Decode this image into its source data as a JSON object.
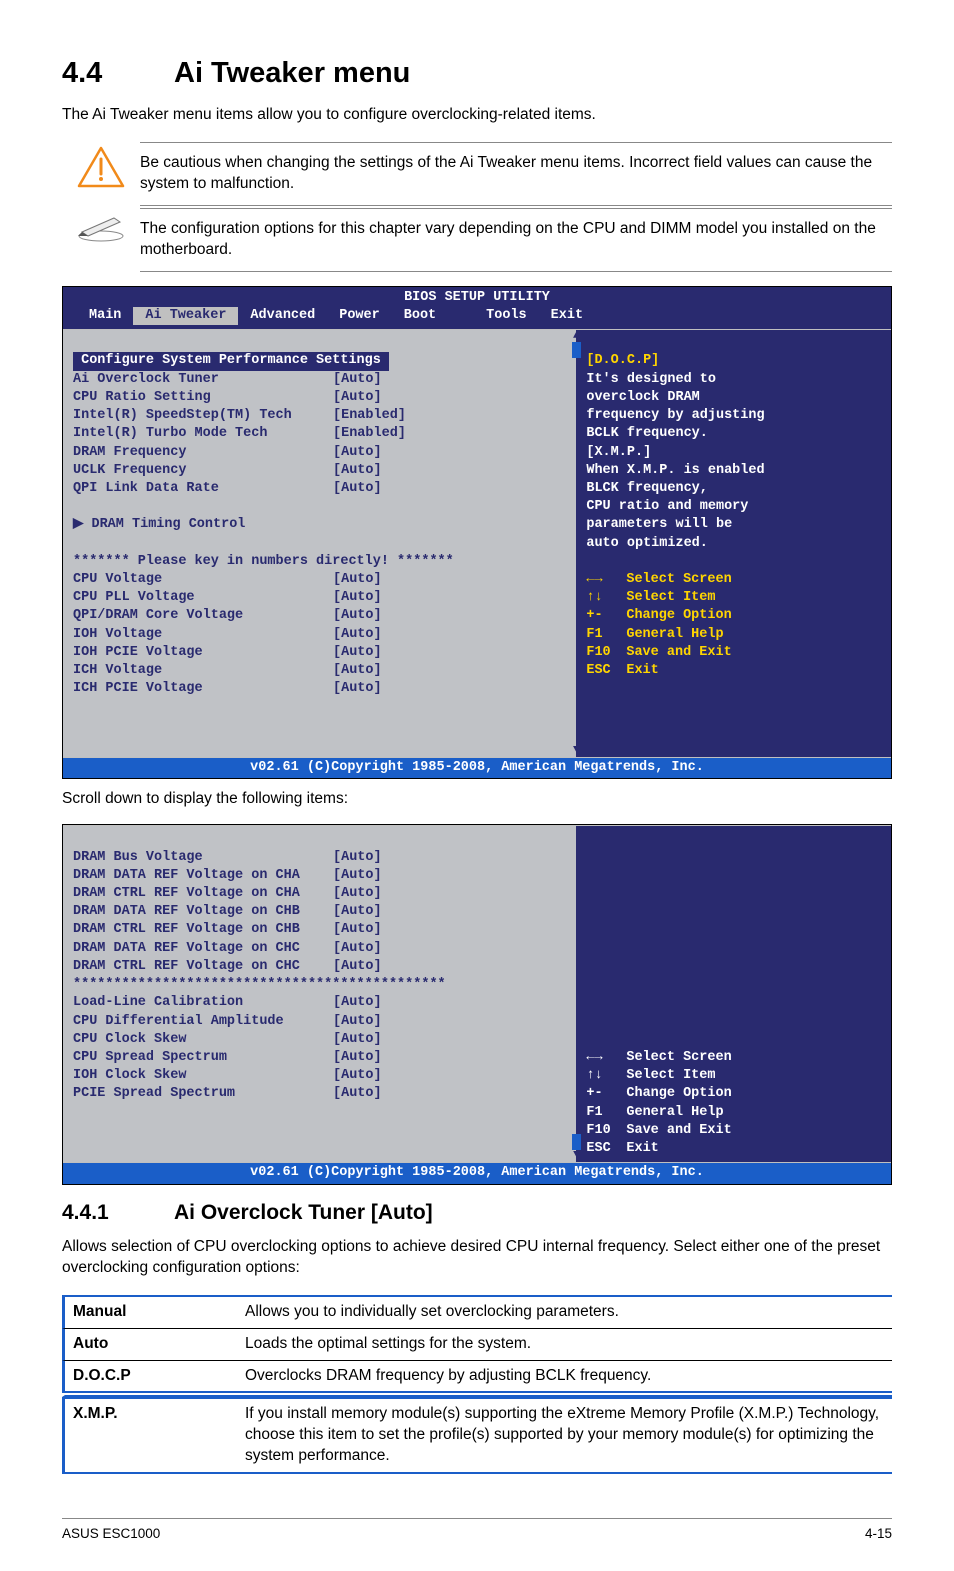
{
  "section": {
    "num": "4.4",
    "title": "Ai Tweaker menu"
  },
  "intro": "The Ai Tweaker menu items allow you to configure overclocking-related items.",
  "callouts": {
    "warn": "Be cautious when changing the settings of the Ai Tweaker menu items. Incorrect field values can cause the system to malfunction.",
    "note": "The configuration options for this chapter vary depending on the CPU and DIMM model you installed on the motherboard."
  },
  "bios": {
    "title": "BIOS SETUP UTILITY",
    "tabs": [
      "Main",
      "Ai Tweaker",
      "Advanced",
      "Power",
      "Boot",
      "Tools",
      "Exit"
    ],
    "active_tab": "Ai Tweaker",
    "heading": "Configure System Performance Settings",
    "rows": [
      {
        "k": "Ai Overclock Tuner",
        "v": "[Auto]"
      },
      {
        "k": "CPU Ratio Setting",
        "v": "[Auto]"
      },
      {
        "k": "Intel(R) SpeedStep(TM) Tech",
        "v": "[Enabled]"
      },
      {
        "k": "Intel(R) Turbo Mode Tech",
        "v": "[Enabled]"
      },
      {
        "k": "DRAM Frequency",
        "v": "[Auto]"
      },
      {
        "k": "UCLK Frequency",
        "v": "[Auto]"
      },
      {
        "k": "QPI Link Data Rate",
        "v": "[Auto]"
      }
    ],
    "submenu": "DRAM Timing Control",
    "desc": {
      "head": "[D.O.C.P]",
      "body": "It's designed to\noverclock DRAM\nfrequency by adjusting\nBCLK frequency.\n[X.M.P.]\nWhen X.M.P. is enabled\nBLCK frequency,\nCPU ratio and memory\nparameters will be\nauto optimized."
    },
    "divider": "******* Please key in numbers directly! *******",
    "rows2": [
      {
        "k": "CPU Voltage",
        "v": "[Auto]"
      },
      {
        "k": "CPU PLL Voltage",
        "v": "[Auto]"
      },
      {
        "k": "QPI/DRAM Core Voltage",
        "v": "[Auto]"
      },
      {
        "k": "IOH Voltage",
        "v": "[Auto]"
      },
      {
        "k": "IOH PCIE Voltage",
        "v": "[Auto]"
      },
      {
        "k": "ICH Voltage",
        "v": "[Auto]"
      },
      {
        "k": "ICH PCIE Voltage",
        "v": "[Auto]"
      }
    ],
    "hints": [
      {
        "k": "←→",
        "v": "Select Screen"
      },
      {
        "k": "↑↓",
        "v": "Select Item"
      },
      {
        "k": "+-",
        "v": "Change Option"
      },
      {
        "k": "F1",
        "v": "General Help"
      },
      {
        "k": "F10",
        "v": "Save and Exit"
      },
      {
        "k": "ESC",
        "v": "Exit"
      }
    ],
    "footer": "v02.61 (C)Copyright 1985-2008, American Megatrends, Inc."
  },
  "scroll_caption": "Scroll down to display the following items:",
  "bios2": {
    "rows": [
      {
        "k": "DRAM Bus Voltage",
        "v": "[Auto]"
      },
      {
        "k": "DRAM DATA REF Voltage on CHA",
        "v": "[Auto]"
      },
      {
        "k": "DRAM CTRL REF Voltage on CHA",
        "v": "[Auto]"
      },
      {
        "k": "DRAM DATA REF Voltage on CHB",
        "v": "[Auto]"
      },
      {
        "k": "DRAM CTRL REF Voltage on CHB",
        "v": "[Auto]"
      },
      {
        "k": "DRAM DATA REF Voltage on CHC",
        "v": "[Auto]"
      },
      {
        "k": "DRAM CTRL REF Voltage on CHC",
        "v": "[Auto]"
      }
    ],
    "divider": "**********************************************",
    "rows2": [
      {
        "k": "Load-Line Calibration",
        "v": "[Auto]"
      },
      {
        "k": "CPU Differential Amplitude",
        "v": "[Auto]"
      },
      {
        "k": "CPU Clock Skew",
        "v": "[Auto]"
      },
      {
        "k": "CPU Spread Spectrum",
        "v": "[Auto]"
      },
      {
        "k": "IOH Clock Skew",
        "v": "[Auto]"
      },
      {
        "k": "PCIE Spread Spectrum",
        "v": "[Auto]"
      }
    ],
    "hints": [
      {
        "k": "←→",
        "v": "Select Screen"
      },
      {
        "k": "↑↓",
        "v": "Select Item"
      },
      {
        "k": "+-",
        "v": "Change Option"
      },
      {
        "k": "F1",
        "v": "General Help"
      },
      {
        "k": "F10",
        "v": "Save and Exit"
      },
      {
        "k": "ESC",
        "v": "Exit"
      }
    ],
    "footer": "v02.61 (C)Copyright 1985-2008, American Megatrends, Inc."
  },
  "subsection": {
    "num": "4.4.1",
    "title": "Ai Overclock Tuner [Auto]"
  },
  "sub_intro": "Allows selection of CPU overclocking options to achieve desired CPU internal frequency. Select either one of the preset overclocking configuration options:",
  "options": [
    {
      "name": "Manual",
      "desc": "Allows you to individually set overclocking parameters."
    },
    {
      "name": "Auto",
      "desc": "Loads the optimal settings for the system."
    },
    {
      "name": "D.O.C.P",
      "desc": "Overclocks DRAM frequency by adjusting BCLK frequency."
    },
    {
      "name": "X.M.P.",
      "desc": "If you install memory module(s) supporting the eXtreme Memory Profile (X.M.P.) Technology, choose this item to set the profile(s) supported by your memory module(s) for optimizing the system performance."
    }
  ],
  "foot": {
    "left": "ASUS ESC1000",
    "right": "4-15"
  }
}
